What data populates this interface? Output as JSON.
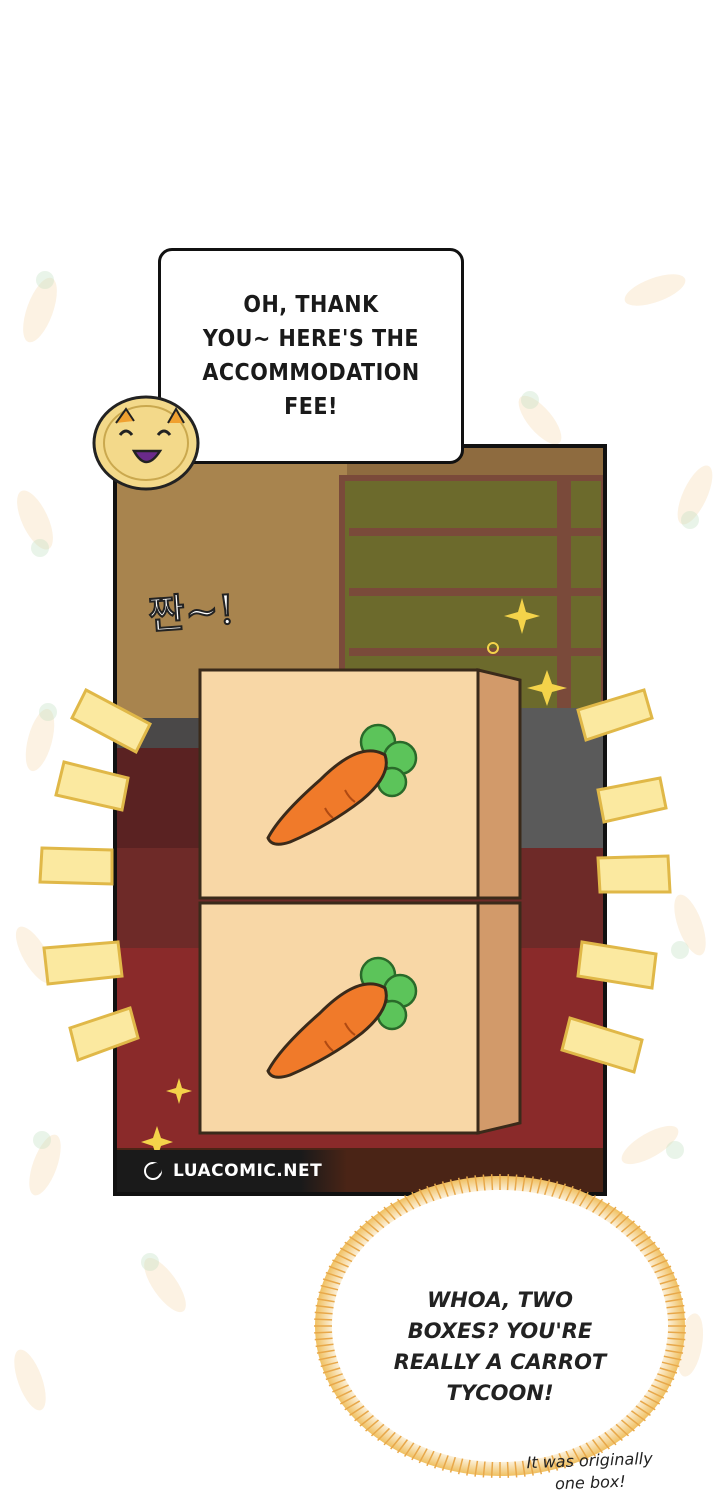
{
  "speech_bubble": {
    "text": "OH, THANK\nYOU~ HERE'S THE\nACCOMMODATION\nFEE!"
  },
  "sfx": {
    "text": "짠~!"
  },
  "watermark": {
    "label": "LUACOMIC.NET"
  },
  "burst_bubble": {
    "text": "WHOA, TWO\nBOXES? YOU'RE\nREALLY A CARROT\nTYCOON!"
  },
  "side_note": {
    "text": "It was originally\none box!"
  },
  "colors": {
    "carrot_orange": "#f07a2a",
    "carrot_leaf": "#5cc45a",
    "box_front": "#f8d7a6",
    "box_side": "#d29a6a",
    "floor_red": "#8a2a2a",
    "ray_yellow": "#fbe9a0"
  }
}
